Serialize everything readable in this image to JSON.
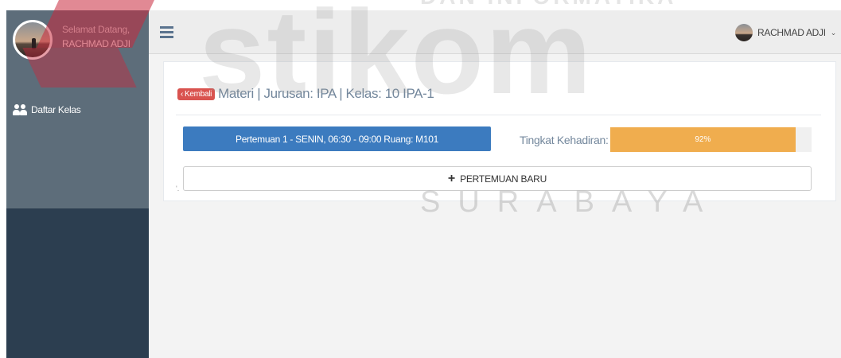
{
  "sidebar": {
    "welcome": "Selamat Datang,",
    "username": "RACHMAD ADJI",
    "items": [
      {
        "label": "Daftar Kelas",
        "icon": "users-icon"
      }
    ]
  },
  "topbar": {
    "menu_icon": "hamburger-icon",
    "user_label": "RACHMAD ADJI",
    "caret": "⌄"
  },
  "panel": {
    "back_label": "Kembali",
    "title": "Materi | Jurusan: IPA | Kelas: 10 IPA-1",
    "meeting_label": "Pertemuan 1 - SENIN, 06:30 - 09:00 Ruang: M101",
    "attendance_label": "Tingkat Kehadiran:",
    "attendance_value": "92%",
    "attendance_fraction": 0.92,
    "new_meeting_label": "PERTEMUAN BARU",
    "tiny_mark": "'."
  },
  "watermark": {
    "word": "stikom",
    "city": "SURABAYA",
    "top_text": "DAN INFORMATIKA"
  },
  "colors": {
    "sidebar_dark": "#2c3e50",
    "sidebar_light": "#5d6d7a",
    "back_button": "#d9534f",
    "meeting_bar": "#3c7bbf",
    "progress": "#f0ad4e",
    "text_muted": "#73879c"
  }
}
